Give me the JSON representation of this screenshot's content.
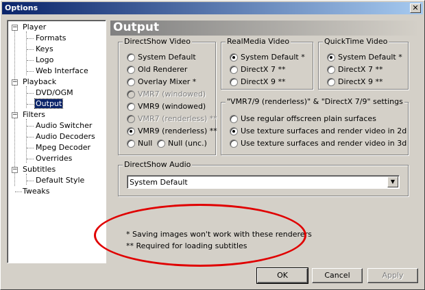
{
  "window": {
    "title": "Options",
    "close_glyph": "✕"
  },
  "tree": {
    "items": [
      {
        "label": "Player",
        "expander": "−"
      },
      {
        "label": "Formats"
      },
      {
        "label": "Keys"
      },
      {
        "label": "Logo"
      },
      {
        "label": "Web Interface"
      },
      {
        "label": "Playback",
        "expander": "−"
      },
      {
        "label": "DVD/OGM"
      },
      {
        "label": "Output",
        "selected": true
      },
      {
        "label": "Filters",
        "expander": "−"
      },
      {
        "label": "Audio Switcher"
      },
      {
        "label": "Audio Decoders"
      },
      {
        "label": "Mpeg Decoder"
      },
      {
        "label": "Overrides"
      },
      {
        "label": "Subtitles",
        "expander": "−"
      },
      {
        "label": "Default Style"
      },
      {
        "label": "Tweaks"
      }
    ]
  },
  "page": {
    "header": "Output"
  },
  "directshow_video": {
    "label": "DirectShow Video",
    "options": [
      {
        "label": "System Default",
        "checked": false,
        "disabled": false
      },
      {
        "label": "Old Renderer",
        "checked": false,
        "disabled": false
      },
      {
        "label": "Overlay Mixer *",
        "checked": false,
        "disabled": false
      },
      {
        "label": "VMR7 (windowed)",
        "checked": false,
        "disabled": true
      },
      {
        "label": "VMR9 (windowed)",
        "checked": false,
        "disabled": false
      },
      {
        "label": "VMR7 (renderless) **",
        "checked": false,
        "disabled": true
      },
      {
        "label": "VMR9 (renderless) **",
        "checked": true,
        "disabled": false
      },
      {
        "label": "Null",
        "checked": false,
        "disabled": false
      },
      {
        "label": "Null (unc.)",
        "checked": false,
        "disabled": false
      }
    ]
  },
  "realmedia_video": {
    "label": "RealMedia Video",
    "options": [
      {
        "label": "System Default *",
        "checked": true
      },
      {
        "label": "DirectX 7 **",
        "checked": false
      },
      {
        "label": "DirectX 9 **",
        "checked": false
      }
    ]
  },
  "quicktime_video": {
    "label": "QuickTime Video",
    "options": [
      {
        "label": "System Default *",
        "checked": true
      },
      {
        "label": "DirectX 7 **",
        "checked": false
      },
      {
        "label": "DirectX 9 **",
        "checked": false
      }
    ]
  },
  "vmr_settings": {
    "label": "\"VMR7/9 (renderless)\" & \"DirectX 7/9\" settings",
    "options": [
      {
        "label": "Use regular offscreen plain surfaces",
        "checked": false
      },
      {
        "label": "Use texture surfaces and render video in 2d",
        "checked": true
      },
      {
        "label": "Use texture surfaces and render video in 3d",
        "checked": false
      }
    ]
  },
  "directshow_audio": {
    "label": "DirectShow Audio",
    "selected": "System Default",
    "arrow_glyph": "▼"
  },
  "notes": {
    "line1": "* Saving images won't work with these renderers",
    "line2": "** Required for loading subtitles"
  },
  "annotation": {
    "color": "#e00000"
  },
  "buttons": {
    "ok": "OK",
    "cancel": "Cancel",
    "apply": "Apply"
  },
  "colors": {
    "titlebar": "#0a246a",
    "selection": "#0a246a",
    "face": "#d4d0c8"
  }
}
